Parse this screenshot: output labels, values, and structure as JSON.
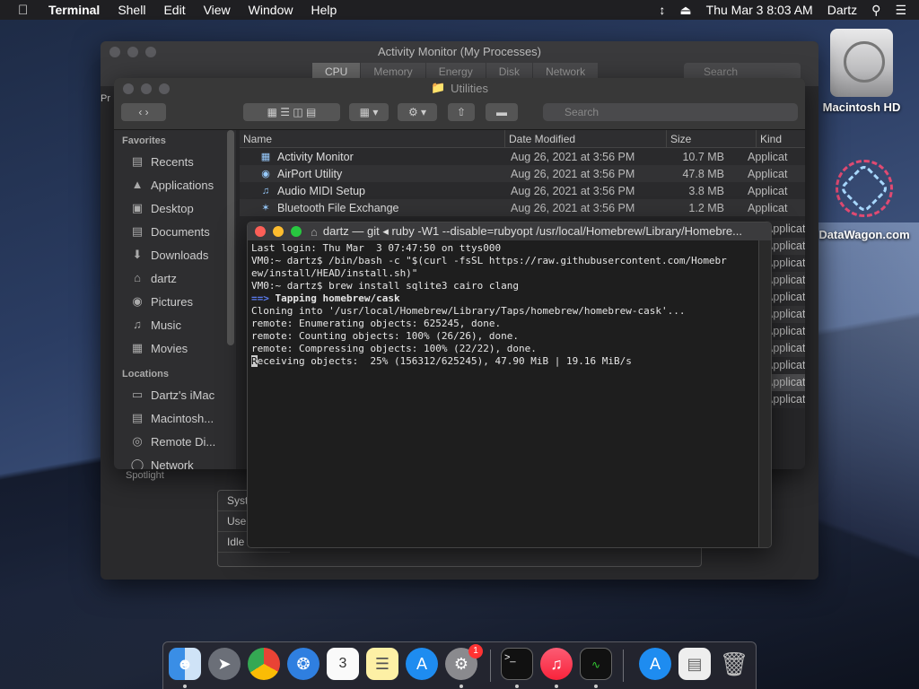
{
  "menubar": {
    "app": "Terminal",
    "items": [
      "Shell",
      "Edit",
      "View",
      "Window",
      "Help"
    ],
    "datetime": "Thu Mar 3  8:03 AM",
    "user": "Dartz"
  },
  "activity_monitor": {
    "title": "Activity Monitor (My Processes)",
    "tabs": [
      "CPU",
      "Memory",
      "Energy",
      "Disk",
      "Network"
    ],
    "search_placeholder": "Search",
    "side_label": "Pr",
    "spotlight": "Spotlight",
    "stats": [
      "Syst",
      "Use",
      "Idle"
    ]
  },
  "finder": {
    "title": "Utilities",
    "search_placeholder": "Search",
    "favorites_header": "Favorites",
    "favorites": [
      {
        "label": "Recents",
        "icon": "recents-icon"
      },
      {
        "label": "Applications",
        "icon": "applications-icon"
      },
      {
        "label": "Desktop",
        "icon": "desktop-icon"
      },
      {
        "label": "Documents",
        "icon": "documents-icon"
      },
      {
        "label": "Downloads",
        "icon": "downloads-icon"
      },
      {
        "label": "dartz",
        "icon": "home-icon"
      },
      {
        "label": "Pictures",
        "icon": "pictures-icon"
      },
      {
        "label": "Music",
        "icon": "music-icon"
      },
      {
        "label": "Movies",
        "icon": "movies-icon"
      }
    ],
    "locations_header": "Locations",
    "locations": [
      {
        "label": "Dartz's iMac",
        "icon": "imac-icon"
      },
      {
        "label": "Macintosh...",
        "icon": "disk-icon"
      },
      {
        "label": "Remote Di...",
        "icon": "remote-disc-icon"
      },
      {
        "label": "Network",
        "icon": "network-icon"
      }
    ],
    "columns": {
      "name": "Name",
      "date": "Date Modified",
      "size": "Size",
      "kind": "Kind"
    },
    "rows": [
      {
        "name": "Activity Monitor",
        "date": "Aug 26, 2021 at 3:56 PM",
        "size": "10.7 MB",
        "kind": "Applicat"
      },
      {
        "name": "AirPort Utility",
        "date": "Aug 26, 2021 at 3:56 PM",
        "size": "47.8 MB",
        "kind": "Applicat"
      },
      {
        "name": "Audio MIDI Setup",
        "date": "Aug 26, 2021 at 3:56 PM",
        "size": "3.8 MB",
        "kind": "Applicat"
      },
      {
        "name": "Bluetooth File Exchange",
        "date": "Aug 26, 2021 at 3:56 PM",
        "size": "1.2 MB",
        "kind": "Applicat"
      }
    ],
    "kind_more": "Applicat"
  },
  "terminal": {
    "title": "dartz — git ◂ ruby -W1 --disable=rubyopt /usr/local/Homebrew/Library/Homebre...",
    "lines": {
      "l1": "Last login: Thu Mar  3 07:47:50 on ttys000",
      "l2": "VM0:~ dartz$ /bin/bash -c \"$(curl -fsSL https://raw.githubusercontent.com/Homebr",
      "l3": "ew/install/HEAD/install.sh)\"",
      "l4": "VM0:~ dartz$ brew install sqlite3 cairo clang",
      "l5_arrow": "==>",
      "l5_text": " Tapping homebrew/cask",
      "l6": "Cloning into '/usr/local/Homebrew/Library/Taps/homebrew/homebrew-cask'...",
      "l7": "remote: Enumerating objects: 625245, done.",
      "l8": "remote: Counting objects: 100% (26/26), done.",
      "l9": "remote: Compressing objects: 100% (22/22), done.",
      "l10_cursor": "R",
      "l10_text": "eceiving objects:  25% (156312/625245), 47.90 MiB | 19.16 MiB/s"
    }
  },
  "desktop": {
    "hd_label": "Macintosh HD",
    "dw_label": "DataWagon.com"
  },
  "dock": {
    "settings_badge": "1"
  }
}
